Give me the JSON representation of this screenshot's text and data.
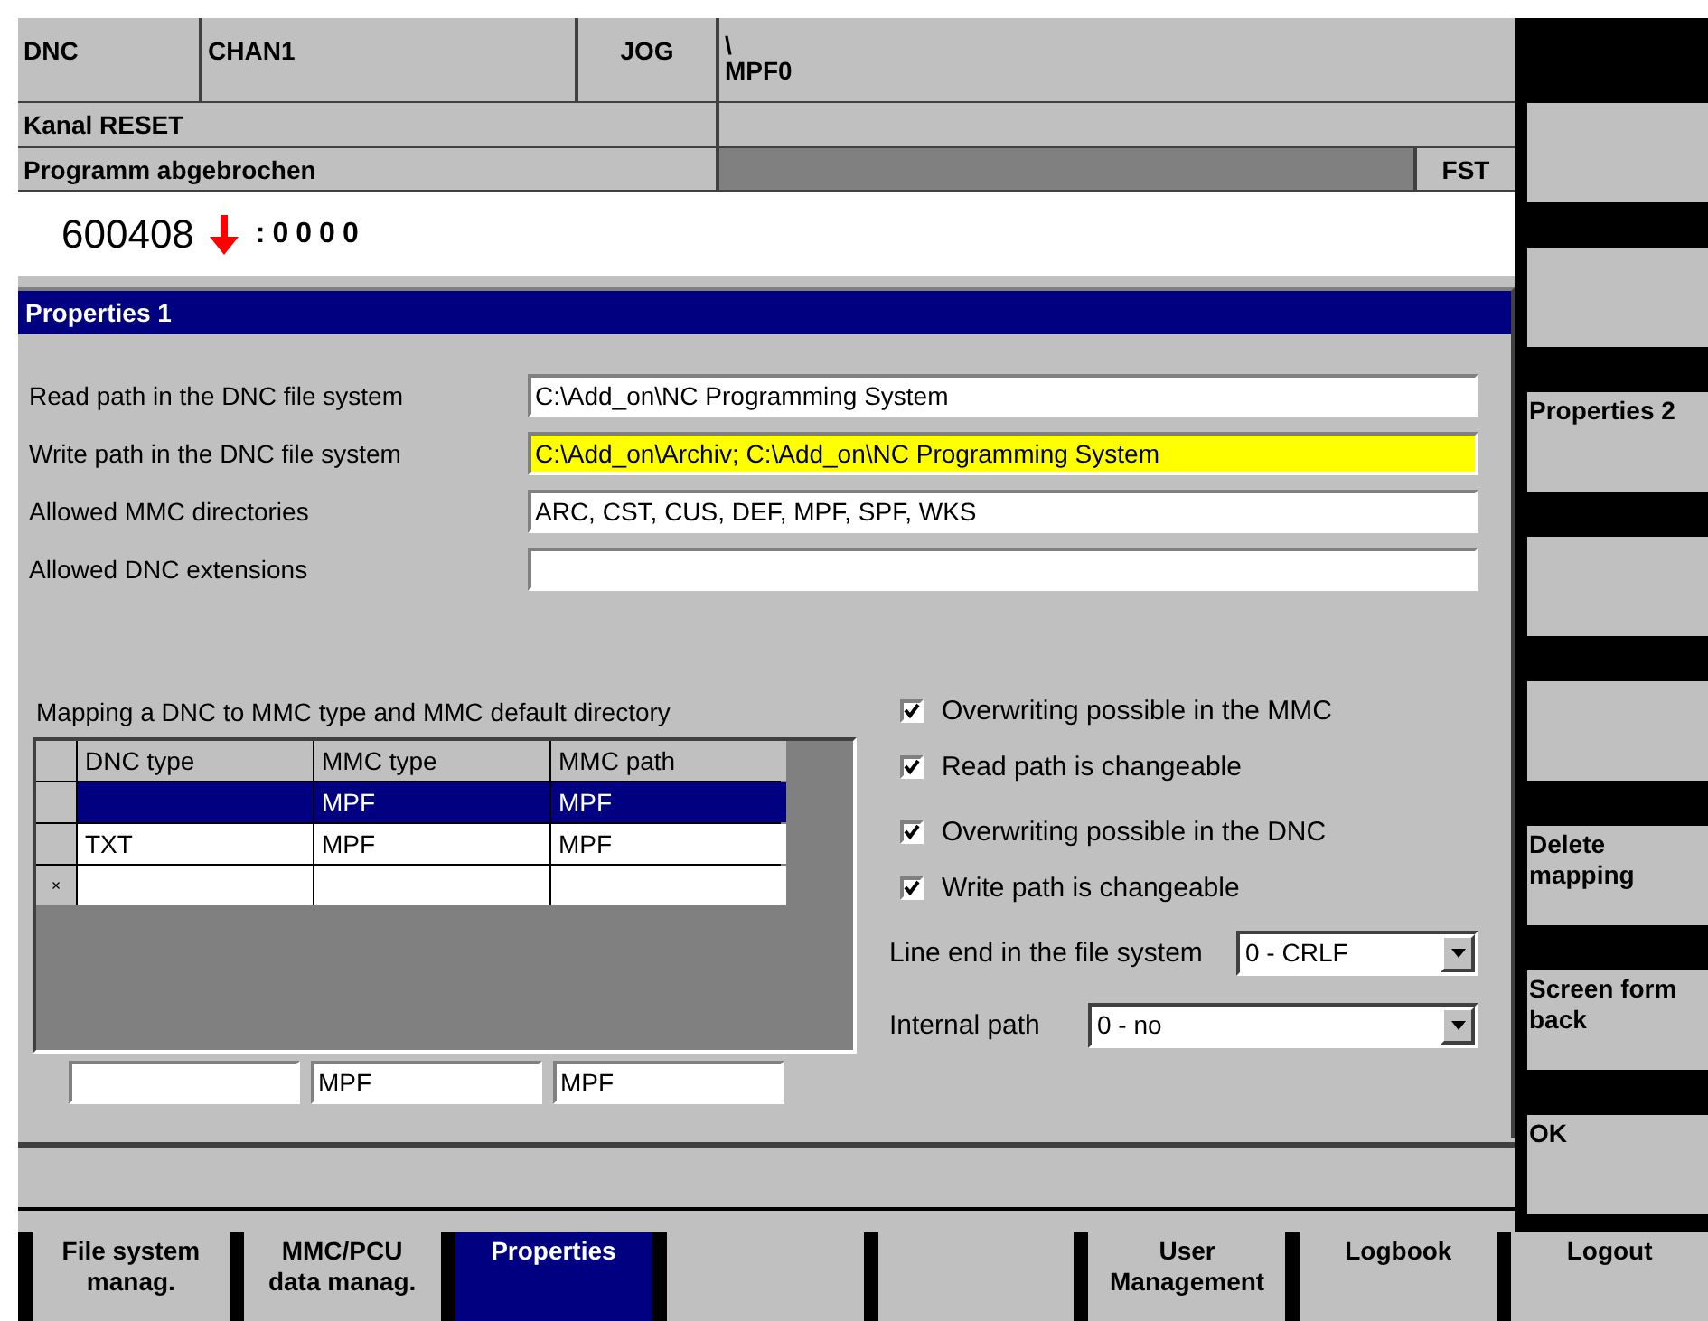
{
  "header": {
    "mode": "DNC",
    "channel": "CHAN1",
    "operating_mode": "JOG",
    "program_path": [
      "\\",
      "MPF0"
    ],
    "channel_status": "Kanal RESET",
    "program_status": "Programm abgebrochen",
    "fst": "FST",
    "block_number": "600408",
    "block_counter": ":0000"
  },
  "dialog": {
    "title": "Properties 1",
    "fields": [
      {
        "label": "Read path in the DNC file system",
        "value": "C:\\Add_on\\NC Programming System",
        "highlighted": false
      },
      {
        "label": "Write path in the DNC file system",
        "value": "C:\\Add_on\\Archiv; C:\\Add_on\\NC Programming System",
        "highlighted": true
      },
      {
        "label": "Allowed MMC directories",
        "value": "ARC, CST, CUS, DEF, MPF, SPF, WKS",
        "highlighted": false
      },
      {
        "label": "Allowed DNC extensions",
        "highlighted": false
      }
    ],
    "mapping": {
      "caption": "Mapping a DNC to MMC type and MMC default directory",
      "columns": [
        "DNC type",
        "MMC type",
        "MMC path"
      ],
      "rows": [
        {
          "cells": {
            "mmc_type": "MPF",
            "mmc_path": "MPF"
          },
          "selected": true
        },
        {
          "cells": {
            "dnc_type": "TXT",
            "mmc_type": "MPF",
            "mmc_path": "MPF"
          },
          "selected": false
        },
        {
          "marker": "×",
          "selected": false
        }
      ],
      "edit_row": {
        "mmc_type": "MPF",
        "mmc_path": "MPF"
      }
    },
    "checkboxes": [
      {
        "label": "Overwriting possible in the MMC",
        "checked": true
      },
      {
        "label": "Read path is changeable",
        "checked": true
      },
      {
        "label": "Overwriting possible in the DNC",
        "checked": true
      },
      {
        "label": "Write path is changeable",
        "checked": true
      }
    ],
    "dropdowns": [
      {
        "label": "Line end in the file system",
        "value": "0 - CRLF"
      },
      {
        "label": "Internal path",
        "value": "0 - no"
      }
    ]
  },
  "vertical_softkeys": [
    {
      "kind": "blank"
    },
    {
      "kind": "blank"
    },
    {
      "kind": "labelled",
      "label": "Properties 2"
    },
    {
      "kind": "blank"
    },
    {
      "kind": "blank"
    },
    {
      "kind": "labelled",
      "label": "Delete\nmapping"
    },
    {
      "kind": "labelled",
      "label": "Screen form\nback"
    },
    {
      "kind": "labelled",
      "label": "OK"
    }
  ],
  "horizontal_softkeys": [
    {
      "label": "File system\nmanag.",
      "selected": false
    },
    {
      "label": "MMC/PCU\ndata manag.",
      "selected": false
    },
    {
      "label": "Properties",
      "selected": true
    },
    {
      "selected": false
    },
    {
      "selected": false
    },
    {
      "label": "User\nManagement",
      "selected": false
    },
    {
      "label": "Logbook",
      "selected": false
    },
    {
      "label": "Logout",
      "selected": false
    }
  ]
}
